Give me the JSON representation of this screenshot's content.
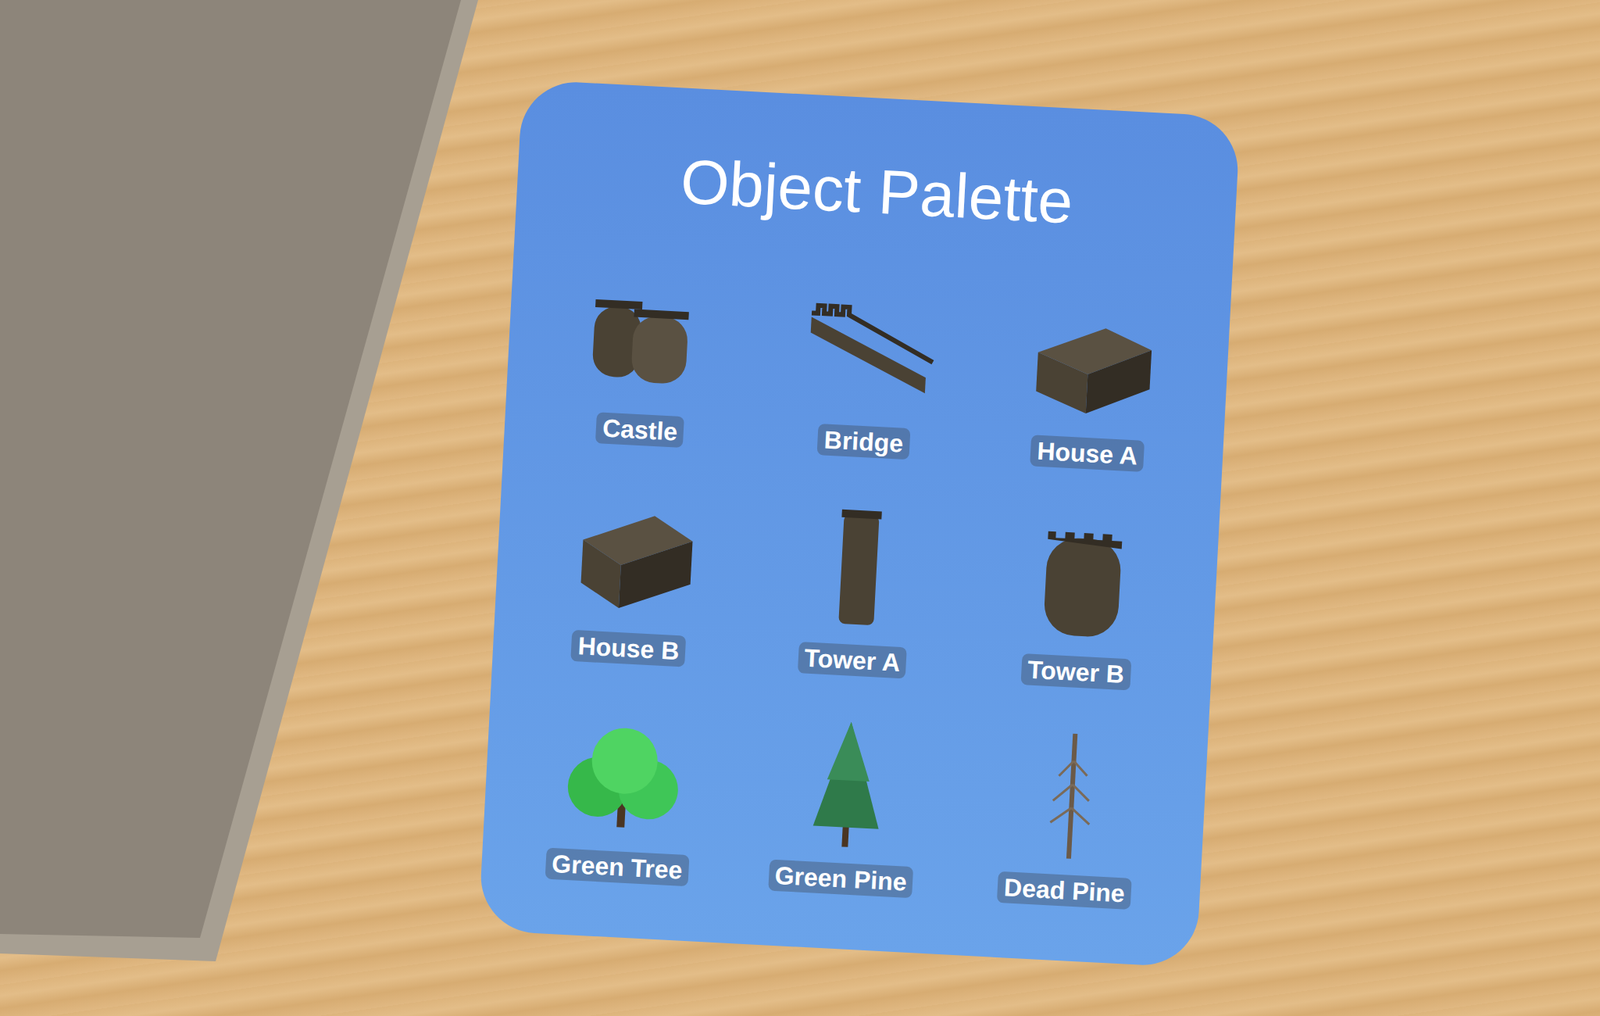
{
  "panel": {
    "title": "Object Palette"
  },
  "items": [
    {
      "label": "Castle"
    },
    {
      "label": "Bridge"
    },
    {
      "label": "House A"
    },
    {
      "label": "House B"
    },
    {
      "label": "Tower A"
    },
    {
      "label": "Tower B"
    },
    {
      "label": "Green Tree"
    },
    {
      "label": "Green Pine"
    },
    {
      "label": "Dead Pine"
    }
  ]
}
